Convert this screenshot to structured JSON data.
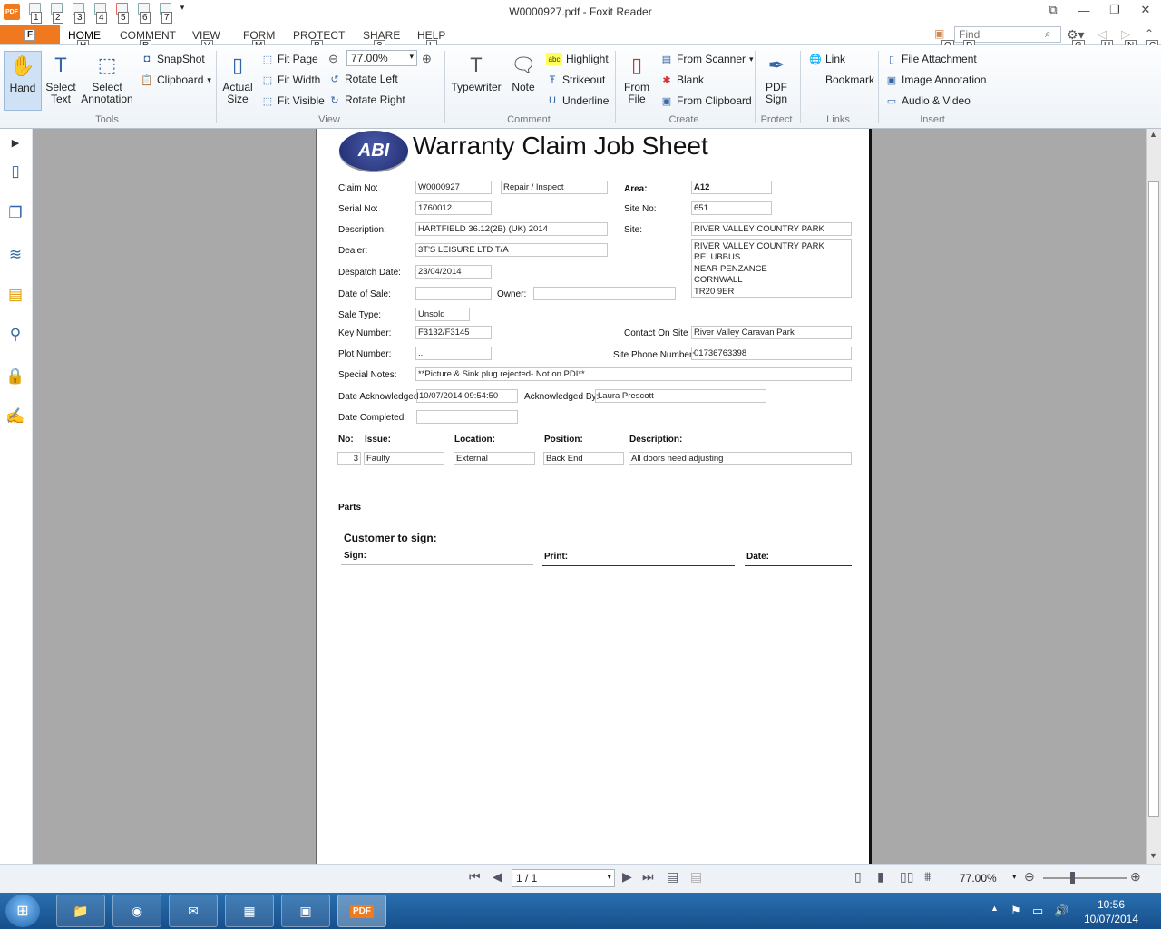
{
  "window": {
    "title": "W0000927.pdf - Foxit Reader",
    "app_logo": "PDF",
    "controls": [
      "⧉",
      "—",
      "❐",
      "✕"
    ]
  },
  "qat": {
    "items": [
      {
        "icon": "open-icon",
        "keytip": "1"
      },
      {
        "icon": "save-icon",
        "keytip": "2"
      },
      {
        "icon": "print-icon",
        "keytip": "3"
      },
      {
        "icon": "email-icon",
        "keytip": "4"
      },
      {
        "icon": "undo-icon",
        "keytip": "5"
      },
      {
        "icon": "redo-icon",
        "keytip": "6"
      },
      {
        "icon": "customize-icon",
        "keytip": "7"
      }
    ]
  },
  "tabs": {
    "file": {
      "label": "F"
    },
    "items": [
      {
        "label": "HOME",
        "keytip": "H"
      },
      {
        "label": "COMMENT",
        "keytip": "R"
      },
      {
        "label": "VIEW",
        "keytip": "V"
      },
      {
        "label": "FORM",
        "keytip": "M"
      },
      {
        "label": "PROTECT",
        "keytip": "P"
      },
      {
        "label": "SHARE",
        "keytip": "S"
      },
      {
        "label": "HELP",
        "keytip": "L"
      }
    ]
  },
  "search": {
    "placeholder": "Find",
    "keytips": [
      "Q",
      "D",
      "G",
      "U",
      "N",
      "C"
    ]
  },
  "ribbon": {
    "tools": {
      "label": "Tools",
      "hand": "Hand",
      "select_text_1": "Select",
      "select_text_2": "Text",
      "select_annot_1": "Select",
      "select_annot_2": "Annotation",
      "snapshot": "SnapShot",
      "clipboard": "Clipboard"
    },
    "view": {
      "label": "View",
      "actual_size_1": "Actual",
      "actual_size_2": "Size",
      "fit_page": "Fit Page",
      "fit_width": "Fit Width",
      "fit_visible": "Fit Visible",
      "zoom": "77.00%",
      "rotate_left": "Rotate Left",
      "rotate_right": "Rotate Right"
    },
    "comment": {
      "label": "Comment",
      "typewriter": "Typewriter",
      "note": "Note",
      "highlight": "Highlight",
      "strikeout": "Strikeout",
      "underline": "Underline"
    },
    "create": {
      "label": "Create",
      "from_file_1": "From",
      "from_file_2": "File",
      "from_scanner": "From Scanner",
      "blank": "Blank",
      "from_clipboard": "From Clipboard"
    },
    "protect": {
      "label": "Protect",
      "pdf_sign_1": "PDF",
      "pdf_sign_2": "Sign"
    },
    "links": {
      "label": "Links",
      "link": "Link",
      "bookmark": "Bookmark"
    },
    "insert": {
      "label": "Insert",
      "file_attachment": "File Attachment",
      "image_annotation": "Image Annotation",
      "audio_video": "Audio & Video"
    }
  },
  "document": {
    "logo": "ABI",
    "title": "Warranty Claim Job Sheet",
    "labels": {
      "claim_no": "Claim No:",
      "serial_no": "Serial No:",
      "description": "Description:",
      "dealer": "Dealer:",
      "despatch_date": "Despatch Date:",
      "date_of_sale": "Date of Sale:",
      "owner": "Owner:",
      "sale_type": "Sale Type:",
      "key_number": "Key Number:",
      "plot_number": "Plot Number:",
      "special_notes": "Special Notes:",
      "date_acknowledged": "Date Acknowledged",
      "acknowledged_by": "Acknowledged By:",
      "date_completed": "Date Completed:",
      "area": "Area:",
      "site_no": "Site No:",
      "site": "Site:",
      "contact_on_site": "Contact On Site",
      "site_phone": "Site Phone Number:"
    },
    "values": {
      "claim_no": "W0000927",
      "claim_type": "Repair / Inspect",
      "serial_no": "1760012",
      "description": "HARTFIELD 36.12(2B) (UK) 2014",
      "dealer": "3T'S LEISURE LTD T/A",
      "despatch_date": "23/04/2014",
      "date_of_sale": "",
      "owner": "",
      "sale_type": "Unsold",
      "key_number": "F3132/F3145",
      "plot_number": "..",
      "special_notes": "**Picture & Sink plug rejected- Not on PDI**",
      "date_acknowledged": "10/07/2014 09:54:50",
      "acknowledged_by": "Laura Prescott",
      "date_completed": "",
      "area": "A12",
      "site_no": "651",
      "site": "RIVER VALLEY COUNTRY PARK",
      "site_address": [
        "RIVER VALLEY COUNTRY PARK",
        "RELUBBUS",
        "NEAR PENZANCE",
        "CORNWALL",
        "TR20 9ER"
      ],
      "contact_on_site": "River Valley Caravan Park",
      "site_phone": "01736763398"
    },
    "issues": {
      "headers": [
        "No:",
        "Issue:",
        "Location:",
        "Position:",
        "Description:"
      ],
      "rows": [
        {
          "no": "3",
          "issue": "Faulty",
          "location": "External",
          "position": "Back End",
          "description": "All doors need adjusting"
        }
      ]
    },
    "parts_label": "Parts",
    "customer_sign": "Customer to sign:",
    "sign": "Sign:",
    "print": "Print:",
    "date": "Date:"
  },
  "status": {
    "page": "1 / 1",
    "zoom": "77.00%"
  },
  "taskbar": {
    "clock_time": "10:56",
    "clock_date": "10/07/2014"
  }
}
